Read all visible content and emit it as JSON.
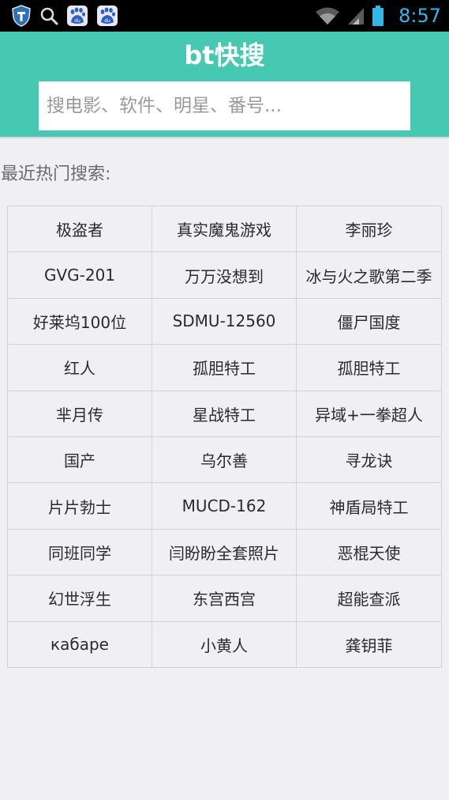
{
  "status_bar": {
    "time": "8:57",
    "icons": [
      "shield-icon",
      "search-icon",
      "baidu-icon",
      "baidu-icon",
      "wifi-icon",
      "signal-icon",
      "battery-icon"
    ]
  },
  "header": {
    "title": "bt快搜",
    "search_placeholder": "搜电影、软件、明星、番号...",
    "background_color": "#47c8b2"
  },
  "section_label": "最近热门搜索:",
  "hot_searches": [
    "极盗者",
    "真实魔鬼游戏",
    "李丽珍",
    "GVG-201",
    "万万没想到",
    "冰与火之歌第二季",
    "好莱坞100位",
    "SDMU-12560",
    "僵尸国度",
    "红人",
    "孤胆特工",
    "孤胆特工",
    "芈月传",
    "星战特工",
    "异域+一拳超人",
    "国产",
    "乌尔善",
    "寻龙诀",
    "片片勃士",
    "MUCD-162",
    "神盾局特工",
    "同班同学",
    "闫盼盼全套照片",
    "恶棍天使",
    "幻世浮生",
    "东宫西宫",
    "超能查派",
    "кабаре",
    "小黄人",
    "龚钥菲"
  ]
}
